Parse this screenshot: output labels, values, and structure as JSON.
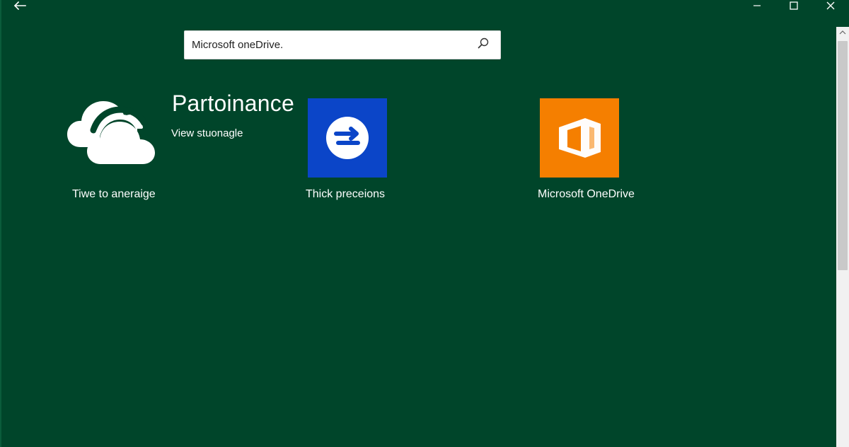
{
  "window": {
    "controls": {
      "back_icon": "back-arrow-icon",
      "minimize_icon": "minimize-icon",
      "maximize_icon": "maximize-icon",
      "close_icon": "close-icon"
    }
  },
  "search": {
    "value": "Microsoft oneDrive.",
    "placeholder": ""
  },
  "hero": {
    "title": "Partoinance",
    "subtitle": "View stuonagle",
    "icon": "cloud-icon",
    "label": "Tiwe to aneraige"
  },
  "apps": [
    {
      "label": "Thick preceions",
      "icon": "swap-arrows-icon",
      "tile_color": "#0b45c8"
    },
    {
      "label": "Microsoft OneDrive",
      "icon": "office-icon",
      "tile_color": "#f57f00"
    }
  ],
  "colors": {
    "background": "#00452a",
    "text": "#ffffff",
    "search_background": "#ffffff",
    "scrollbar_track": "#f1f1f1",
    "scrollbar_thumb": "#c9c9c9"
  }
}
